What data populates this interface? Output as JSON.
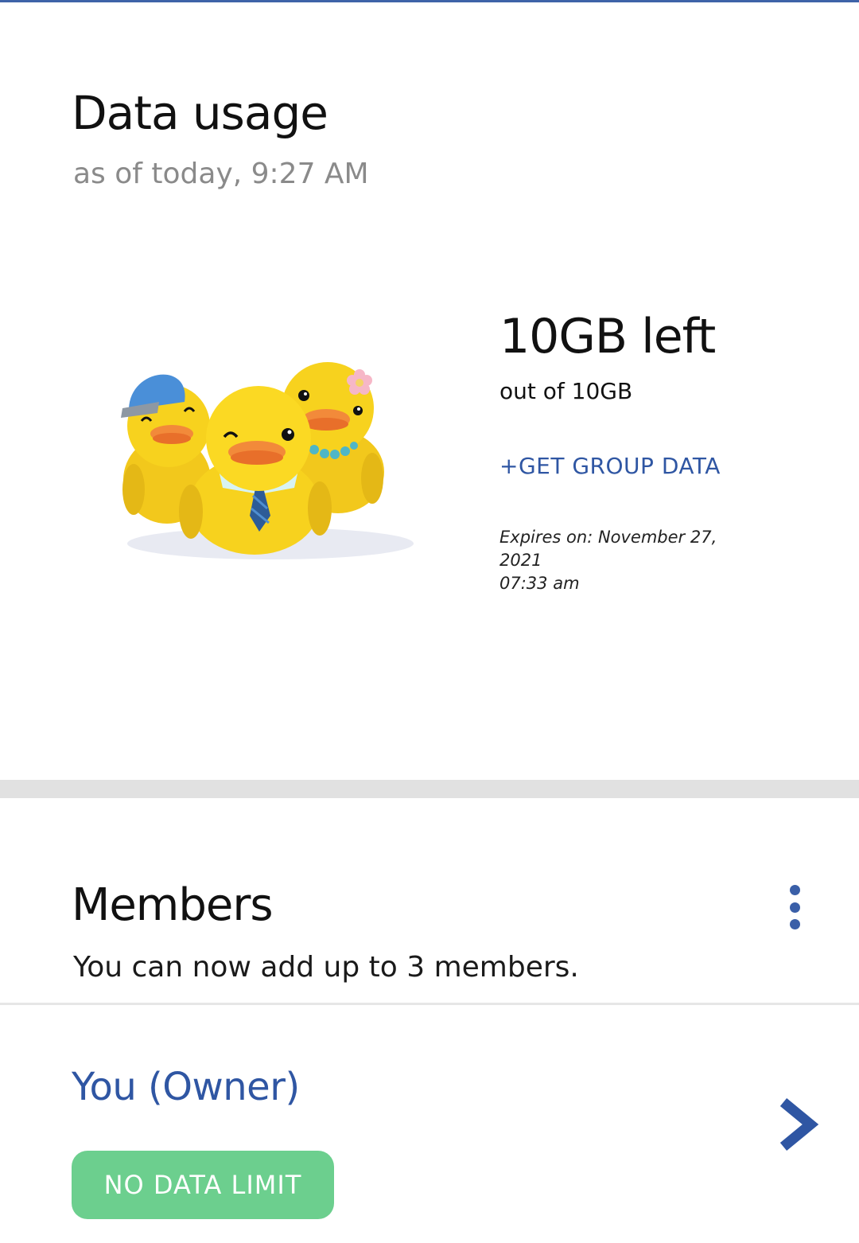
{
  "data_usage": {
    "title": "Data usage",
    "as_of": "as of today, 9:27 AM",
    "left_amount": "10GB left",
    "out_of": "out of 10GB",
    "get_group_data": "+GET GROUP DATA",
    "expires_line1": "Expires on: November 27, 2021",
    "expires_line2": "07:33 am",
    "illustration": "three-rubber-ducks"
  },
  "members": {
    "title": "Members",
    "subtitle": "You can now add up to 3 members.",
    "more_icon": "more-vertical-icon",
    "list": [
      {
        "name": "You (Owner)",
        "badge": "NO DATA LIMIT",
        "chevron_icon": "chevron-right-icon"
      }
    ]
  },
  "colors": {
    "accent": "#2f56a3",
    "badge": "#6ccf8e",
    "divider": "#e1e1e1",
    "top_line": "#3e63a8",
    "duck_yellow": "#f7d21e"
  }
}
